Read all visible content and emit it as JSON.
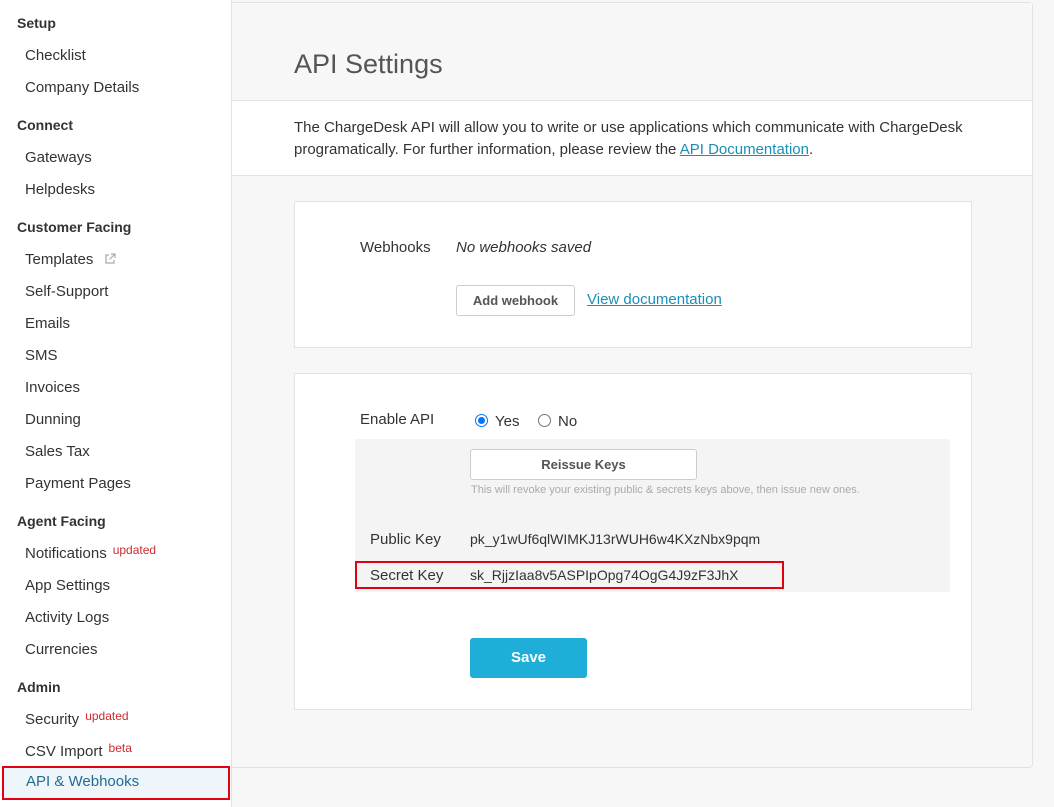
{
  "sidebar": {
    "sections": [
      {
        "heading": "Setup",
        "items": [
          {
            "label": "Checklist"
          },
          {
            "label": "Company Details"
          }
        ]
      },
      {
        "heading": "Connect",
        "items": [
          {
            "label": "Gateways"
          },
          {
            "label": "Helpdesks"
          }
        ]
      },
      {
        "heading": "Customer Facing",
        "items": [
          {
            "label": "Templates"
          },
          {
            "label": "Self-Support"
          },
          {
            "label": "Emails"
          },
          {
            "label": "SMS"
          },
          {
            "label": "Invoices"
          },
          {
            "label": "Dunning"
          },
          {
            "label": "Sales Tax"
          },
          {
            "label": "Payment Pages"
          }
        ]
      },
      {
        "heading": "Agent Facing",
        "items": [
          {
            "label": "Notifications",
            "badge": "updated"
          },
          {
            "label": "App Settings"
          },
          {
            "label": "Activity Logs"
          },
          {
            "label": "Currencies"
          }
        ]
      },
      {
        "heading": "Admin",
        "items": [
          {
            "label": "Security",
            "badge": "updated"
          },
          {
            "label": "CSV Import",
            "badge": "beta"
          },
          {
            "label": "API & Webhooks"
          }
        ]
      }
    ]
  },
  "page": {
    "title": "API Settings",
    "intro_text": "The ChargeDesk API will allow you to write or use applications which communicate with ChargeDesk programatically. For further information, please review the ",
    "intro_link": "API Documentation",
    "intro_end": "."
  },
  "webhooks": {
    "label": "Webhooks",
    "empty_text": "No webhooks saved",
    "add_button": "Add webhook",
    "docs_link": "View documentation"
  },
  "api": {
    "enable_label": "Enable API",
    "yes_label": "Yes",
    "no_label": "No",
    "selected": "Yes",
    "reissue_button": "Reissue Keys",
    "reissue_hint": "This will revoke your existing public & secrets keys above, then issue new ones.",
    "public_key_label": "Public Key",
    "public_key_value": "pk_y1wUf6qlWIMKJ13rWUH6w4KXzNbx9pqm",
    "secret_key_label": "Secret Key",
    "secret_key_value": "sk_RjjzIaa8v5ASPIpOpg74OgG4J9zF3JhX",
    "save_button": "Save"
  },
  "colors": {
    "accent": "#1eaed8",
    "link": "#1a8fb5",
    "highlight": "#e3000f",
    "badge": "#cc2b2b"
  }
}
